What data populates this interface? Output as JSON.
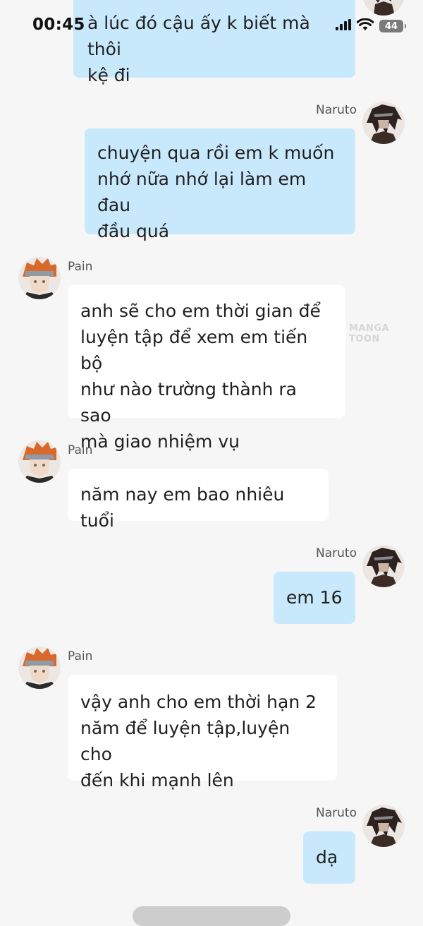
{
  "status_bar": {
    "time": "00:45",
    "battery": "44"
  },
  "messages": [
    {
      "sender": "Naruto",
      "type": "sent",
      "text": "à lúc đó cậu ấy k biết mà thôi\nkệ đi"
    },
    {
      "sender": "Naruto",
      "type": "sent",
      "text": "chuyện qua rồi em k muốn\nnhớ nữa nhớ lại làm em đau\nđầu quá"
    },
    {
      "sender": "Pain",
      "type": "received",
      "text": "anh sẽ cho em thời gian để\nluyện tập để xem em tiến bộ\nnhư nào trường thành ra sao\nmà giao nhiệm vụ"
    },
    {
      "sender": "Pain",
      "type": "received",
      "text": "năm nay em bao nhiêu tuổi"
    },
    {
      "sender": "Naruto",
      "type": "sent",
      "text": "em 16"
    },
    {
      "sender": "Pain",
      "type": "received",
      "text": "vậy anh cho em thời hạn 2\nnăm để luyện tập,luyện cho\nđến khi mạnh lên"
    },
    {
      "sender": "Naruto",
      "type": "sent",
      "text": "dạ"
    }
  ],
  "watermark": "MANGA TOON",
  "colors": {
    "sent_bubble": "#c8e9fb",
    "received_bubble": "#ffffff",
    "background": "#f6f6f6"
  }
}
